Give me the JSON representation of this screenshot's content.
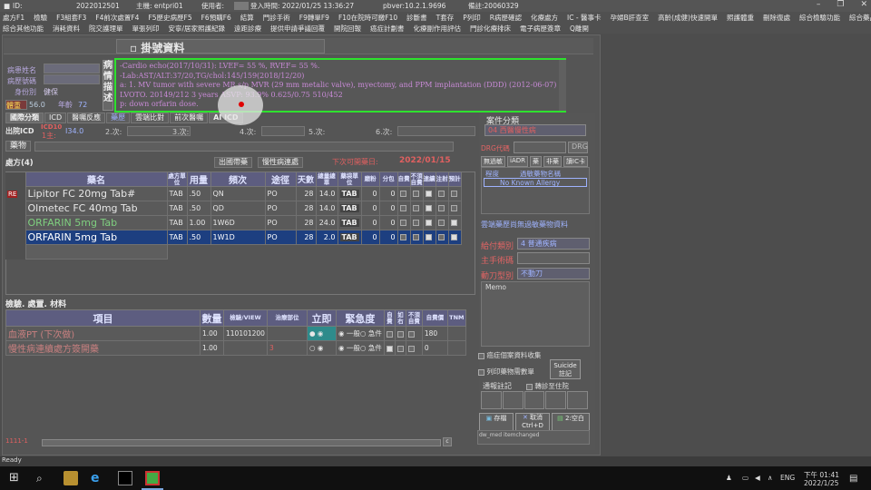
{
  "titlebar": {
    "id_label": "ID:",
    "date_id": "2022012501",
    "host": "主機: entpri01",
    "user_label": "使用者:",
    "login_time": "登入時間: 2022/01/25 13:36:27",
    "pbver": "pbver:10.2.1.9696",
    "note": "備註:20060329"
  },
  "menu1": [
    "處方F1",
    "檢驗",
    "F3組套F3",
    "F4前次處置F4",
    "F5歷史病歷F5",
    "F6預購F6",
    "結算",
    "門診手術",
    "F9轉單F9",
    "F10在院時可繳F10",
    "診斷書",
    "T套存",
    "P列印",
    "R病歷確認",
    "化療處方",
    "IC - 醫事卡",
    "孕婦B肝查室",
    "高齡(成健)快速開單",
    "照護體重",
    "刪除復處",
    "綜合檢驗功能",
    "綜合藥品功能"
  ],
  "menu2": [
    "綜合其他功能",
    "消耗資料",
    "院交護理單",
    "單張列印",
    "安寧/居家照護紀錄",
    "遠距診療",
    "提供申請爭議回覆",
    "開院回報",
    "癌症計劃書",
    "化療副作用評估",
    "門診化療排床",
    "電子病歷簽章",
    "Q離開"
  ],
  "header": {
    "title": "掛號資料"
  },
  "patient": {
    "name_label": "病患姓名",
    "chart_label": "病歷號碼",
    "id_label": "身份別",
    "id_value": "健保",
    "weight_label": "體重",
    "weight_value": "56.0",
    "age_label": "年齡",
    "age_value": "72"
  },
  "side_label": "病情描述",
  "info_lines": [
    "-Cardio echo(2017/10/31): LVEF= 55 %, RVEF= 55 %.",
    "-Lab:AST/ALT:37/20,TG/chol:145/159(2018/12/20)",
    "a: 1. MV tumor with severe MR s/p MVR (29 mm metalic valve), myectomy, and PPM implantation (DDD) (2012-06-07) 2.",
    "LVOTO.  20149/212 3 years ASVP: 93.9%  0.625/0.75  510/452",
    "p: down orfarin dose."
  ],
  "tabs": [
    "國際分類",
    "ICD",
    "醫囑反應",
    "藥歷",
    "雲端比對",
    "前次醫囑",
    "AI ICD"
  ],
  "diag": {
    "out_label": "出院ICD",
    "icd10_label": "ICD10",
    "main_label": "1主:",
    "main_code": "I34.0",
    "second": "2.次:",
    "third": "3.次:",
    "fourth": "4.次:",
    "fifth": "5.次:",
    "sixth": "6.次:"
  },
  "drug_label": "藥物",
  "rx": {
    "label": "處方(4)",
    "home_btn": "出國帶藥",
    "chronic_btn": "慢性病連處",
    "next_label": "下次可開藥日:",
    "next_date": "2022/01/15"
  },
  "drug_headers": [
    "藥名",
    "處方單位",
    "用量",
    "頻次",
    "途徑",
    "天數",
    "總量總單",
    "藥袋單位",
    "磨粉",
    "分包",
    "自費",
    "不須自費",
    "連續",
    "注射",
    "預計"
  ],
  "drugs": [
    {
      "badge": "RE",
      "name": "Lipitor FC 20mg Tab#",
      "unit": "TAB",
      "dose": ".50",
      "freq": "QN",
      "route": "PO",
      "days": "28",
      "total": "14.0",
      "bag": "TAB",
      "grind": "0",
      "pack": "0"
    },
    {
      "badge": "",
      "name": "Olmetec FC 40mg Tab",
      "unit": "TAB",
      "dose": ".50",
      "freq": "QD",
      "route": "PO",
      "days": "28",
      "total": "14.0",
      "bag": "TAB",
      "grind": "0",
      "pack": "0"
    },
    {
      "badge": "",
      "name": "ORFARIN 5mg Tab",
      "unit": "TAB",
      "dose": "1.00",
      "freq": "1W6D",
      "route": "PO",
      "days": "28",
      "total": "24.0",
      "bag": "TAB",
      "grind": "0",
      "pack": "0"
    },
    {
      "badge": "",
      "name": "ORFARIN 5mg Tab",
      "unit": "TAB",
      "dose": ".50",
      "freq": "1W1D",
      "route": "PO",
      "days": "28",
      "total": "2.0",
      "bag": "TAB",
      "grind": "0",
      "pack": "0"
    }
  ],
  "proc": {
    "label": "檢驗. 處置. 材料",
    "headers": [
      "項目",
      "數量",
      "檢驗/VIEW",
      "治療部位",
      "立即",
      "緊急度",
      "自費",
      "如右",
      "不須自費",
      "自費價",
      "TNM"
    ],
    "rows": [
      {
        "name": "血液PT (下次做)",
        "qty": "1.00",
        "code": "110101200",
        "site": "",
        "urgency": "一般",
        "urgency2": "急件",
        "price": "180"
      },
      {
        "name": "慢性病連續處方簽開藥",
        "qty": "1.00",
        "code": "",
        "site": "3",
        "urgency": "一般",
        "urgency2": "急件",
        "price": "0"
      }
    ]
  },
  "right": {
    "case_label": "案件分類",
    "case_value": "04  西醫慢性病",
    "drg_label": "DRG代碼",
    "drg_btn": "DRG",
    "allergy_tabs": [
      "無過敏",
      "iADR",
      "藥",
      "非藥",
      "讀IC卡"
    ],
    "allergy_cols": [
      "程度",
      "過敏藥物名稱"
    ],
    "allergy_value": "No Known Allergy",
    "cloud_link": "雲端藥歷尚無過敏藥物資料",
    "pay_label": "給付類別",
    "pay_value": "4  普通疾病",
    "diag_code_label": "主手術碼",
    "op_label": "動刀型別",
    "op_value": "不動刀",
    "memo_label": "Memo",
    "check1": "癌症個案資料收集",
    "check2": "列印藥物需數單",
    "suicide_btn": "Suicide註記",
    "notify_label": "通報註記",
    "transfer_label": "轉診至住院",
    "btn_save": "存檔",
    "btn_cancel": "取消 Ctrl+D",
    "btn_clear": "2:空白",
    "status_line": "dw_med  itemchanged"
  },
  "footer_code": "1111-1",
  "statusbar_text": "Ready",
  "taskbar": {
    "time": "下午 01:41",
    "date": "2022/1/25",
    "lang": "ENG"
  }
}
